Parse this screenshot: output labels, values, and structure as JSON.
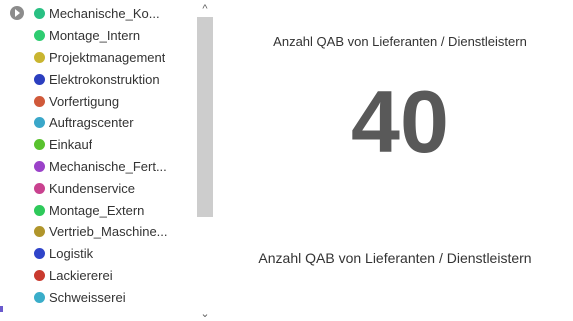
{
  "legend": {
    "items": [
      {
        "label": "Mechanische_Ko...",
        "color": "#29c083"
      },
      {
        "label": "Montage_Intern",
        "color": "#2ecc71"
      },
      {
        "label": "Projektmanagement",
        "color": "#c9b530"
      },
      {
        "label": "Elektrokonstruktion",
        "color": "#2b3fbf"
      },
      {
        "label": "Vorfertigung",
        "color": "#d0593a"
      },
      {
        "label": "Auftragscenter",
        "color": "#3aa7c9"
      },
      {
        "label": "Einkauf",
        "color": "#59c22e"
      },
      {
        "label": "Mechanische_Fert...",
        "color": "#9b42c9"
      },
      {
        "label": "Kundenservice",
        "color": "#c9428f"
      },
      {
        "label": "Montage_Extern",
        "color": "#2ec95a"
      },
      {
        "label": "Vertrieb_Maschine...",
        "color": "#b0952b"
      },
      {
        "label": "Logistik",
        "color": "#2f44c9"
      },
      {
        "label": "Lackiererei",
        "color": "#c93a2e"
      },
      {
        "label": "Schweisserei",
        "color": "#3aadc9"
      }
    ]
  },
  "scrollbar": {
    "up_arrow": "^",
    "down_arrow": "⌄"
  },
  "kpi": {
    "title": "Anzahl QAB von Lieferanten / Dienstleistern",
    "value": "40",
    "caption": "Anzahl QAB von Lieferanten / Dienstleistern"
  }
}
